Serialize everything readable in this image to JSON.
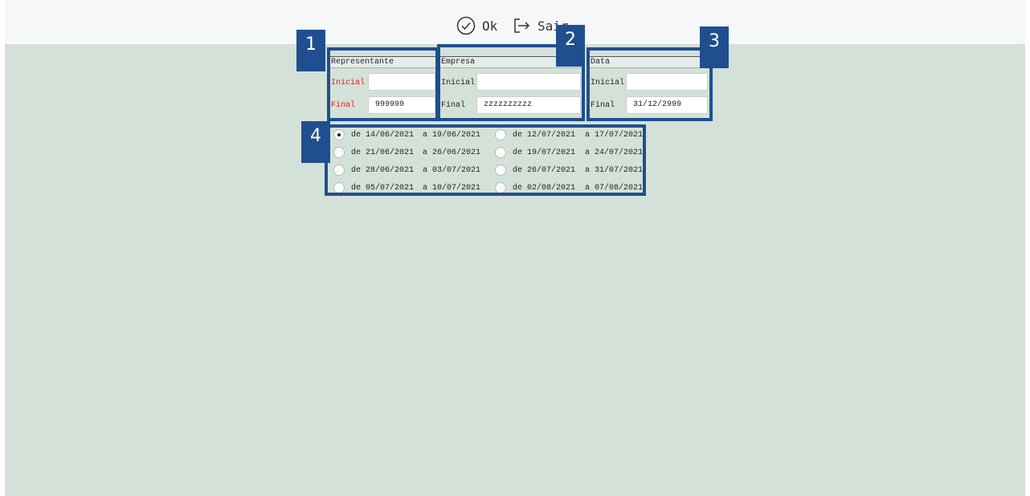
{
  "toolbar": {
    "ok_label": "Ok",
    "sair_label": "Sair",
    "ok_icon": "check-circle-icon",
    "sair_icon": "exit-icon"
  },
  "markers": [
    "1",
    "2",
    "3",
    "4"
  ],
  "representante": {
    "title": "Representante",
    "inicial_label": "Inicial",
    "inicial_value": "",
    "final_label": "Final",
    "final_value": "999999"
  },
  "empresa": {
    "title": "Empresa",
    "inicial_label": "Inicial",
    "inicial_value": "",
    "final_label": "Final",
    "final_value": "zzzzzzzzzz"
  },
  "data": {
    "title": "Data",
    "inicial_label": "Inicial",
    "inicial_value": "",
    "final_label": "Final",
    "final_value": "31/12/2999"
  },
  "periods": {
    "left": [
      {
        "from": "de 14/06/2021",
        "to": "a 19/06/2021",
        "selected": true
      },
      {
        "from": "de 21/06/2021",
        "to": "a 26/06/2021",
        "selected": false
      },
      {
        "from": "de 28/06/2021",
        "to": "a 03/07/2021",
        "selected": false
      },
      {
        "from": "de 05/07/2021",
        "to": "a 10/07/2021",
        "selected": false
      }
    ],
    "right": [
      {
        "from": "de 12/07/2021",
        "to": "a 17/07/2021",
        "selected": false
      },
      {
        "from": "de 19/07/2021",
        "to": "a 24/07/2021",
        "selected": false
      },
      {
        "from": "de 26/07/2021",
        "to": "a 31/07/2021",
        "selected": false
      },
      {
        "from": "de 02/08/2021",
        "to": "a 07/08/2021",
        "selected": false
      }
    ]
  },
  "colors": {
    "background": "#d4e1d8",
    "toolbar": "#f6f7f8",
    "annotation": "#1f4f8f",
    "required_label": "#e02020"
  }
}
